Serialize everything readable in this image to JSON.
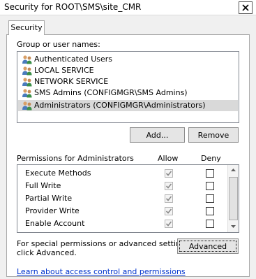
{
  "window": {
    "title": "Security for ROOT\\SMS\\site_CMR"
  },
  "tabs": [
    {
      "label": "Security"
    }
  ],
  "users": {
    "label": "Group or user names:",
    "items": [
      {
        "label": "Authenticated Users",
        "selected": false
      },
      {
        "label": "LOCAL SERVICE",
        "selected": false
      },
      {
        "label": "NETWORK SERVICE",
        "selected": false
      },
      {
        "label": "SMS Admins (CONFIGMGR\\SMS Admins)",
        "selected": false
      },
      {
        "label": "Administrators (CONFIGMGR\\Administrators)",
        "selected": true
      }
    ],
    "add_label": "Add...",
    "remove_label": "Remove"
  },
  "permissions": {
    "header": "Permissions for Administrators",
    "allow_header": "Allow",
    "deny_header": "Deny",
    "rows": [
      {
        "name": "Execute Methods",
        "allow": true,
        "deny": false
      },
      {
        "name": "Full Write",
        "allow": true,
        "deny": false
      },
      {
        "name": "Partial Write",
        "allow": true,
        "deny": false
      },
      {
        "name": "Provider Write",
        "allow": true,
        "deny": false
      },
      {
        "name": "Enable Account",
        "allow": true,
        "deny": false
      }
    ]
  },
  "advanced": {
    "note": "For special permissions or advanced settings, click Advanced.",
    "note_line1": "For special permissions or advanced settings,",
    "note_line2": "click Advanced.",
    "button_label": "Advanced"
  },
  "footer": {
    "link": "Learn about access control and permissions"
  },
  "colors": {
    "link": "#0033cc",
    "selection": "#d9d9d9",
    "checkmark_disabled": "#8a8a8a"
  },
  "icons": {
    "user_item": "users-group-icon",
    "close": "close-icon",
    "checkmark": "checkmark-icon"
  }
}
